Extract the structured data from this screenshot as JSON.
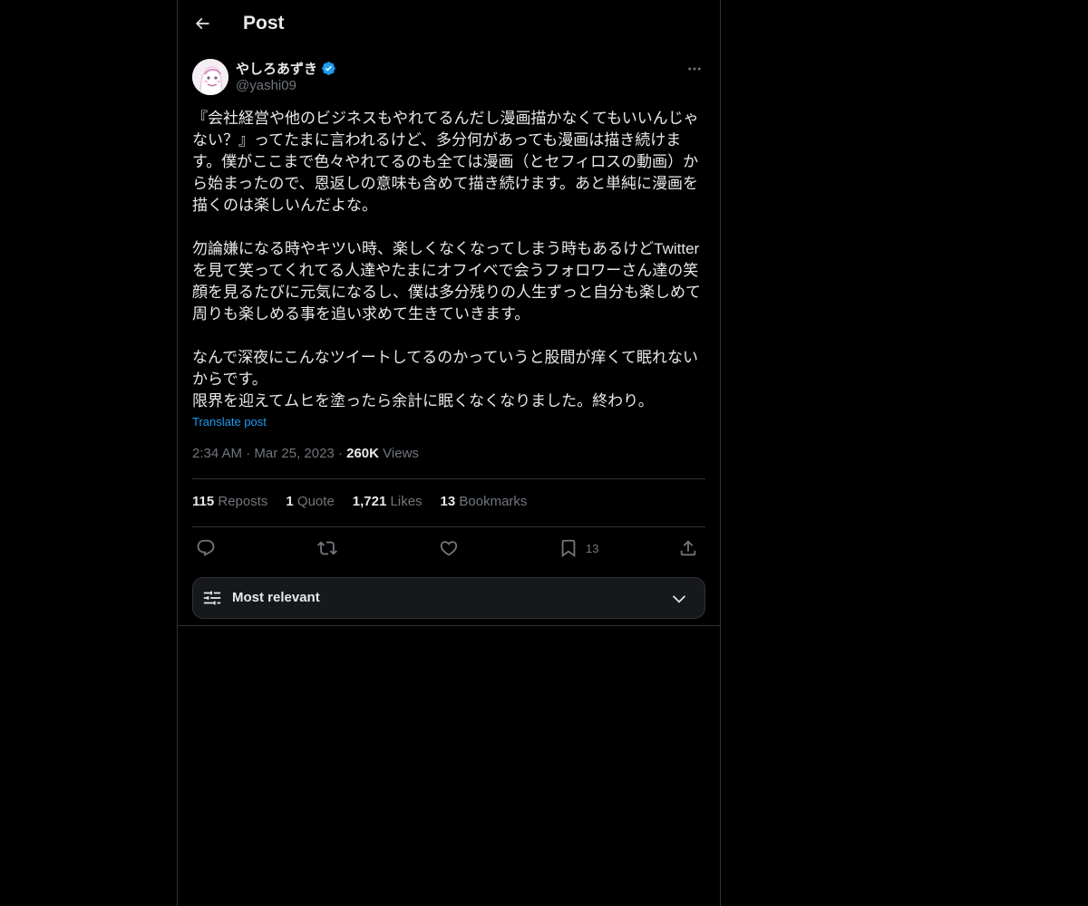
{
  "header": {
    "title": "Post"
  },
  "author": {
    "display_name": "やしろあずき",
    "handle": "@yashi09",
    "verified": true
  },
  "tweet": {
    "text": "『会社経営や他のビジネスもやれてるんだし漫画描かなくてもいいんじゃない？』ってたまに言われるけど、多分何があっても漫画は描き続けます。僕がここまで色々やれてるのも全ては漫画（とセフィロスの動画）から始まったので、恩返しの意味も含めて描き続けます。あと単純に漫画を描くのは楽しいんだよな。\n\n勿論嫌になる時やキツい時、楽しくなくなってしまう時もあるけどTwitterを見て笑ってくれてる人達やたまにオフイベで会うフォロワーさん達の笑顔を見るたびに元気になるし、僕は多分残りの人生ずっと自分も楽しめて周りも楽しめる事を追い求めて生きていきます。\n\nなんで深夜にこんなツイートしてるのかっていうと股間が痒くて眠れないからです。\n限界を迎えてムヒを塗ったら余計に眠くなくなりました。終わり。",
    "translate_label": "Translate post",
    "time": "2:34 AM",
    "date": "Mar 25, 2023",
    "views_count": "260K",
    "views_label": "Views"
  },
  "stats": {
    "reposts_count": "115",
    "reposts_label": "Reposts",
    "quotes_count": "1",
    "quotes_label": "Quote",
    "likes_count": "1,721",
    "likes_label": "Likes",
    "bookmarks_count": "13",
    "bookmarks_label": "Bookmarks"
  },
  "actions": {
    "reply_icon": "reply-icon",
    "repost_icon": "repost-icon",
    "like_icon": "heart-icon",
    "bookmark_icon": "bookmark-icon",
    "bookmark_count": "13",
    "share_icon": "share-icon"
  },
  "sort": {
    "label": "Most relevant"
  },
  "colors": {
    "background": "#000000",
    "text": "#e7e9ea",
    "secondary": "#71767b",
    "accent": "#1d9bf0",
    "border": "#2f3336"
  }
}
